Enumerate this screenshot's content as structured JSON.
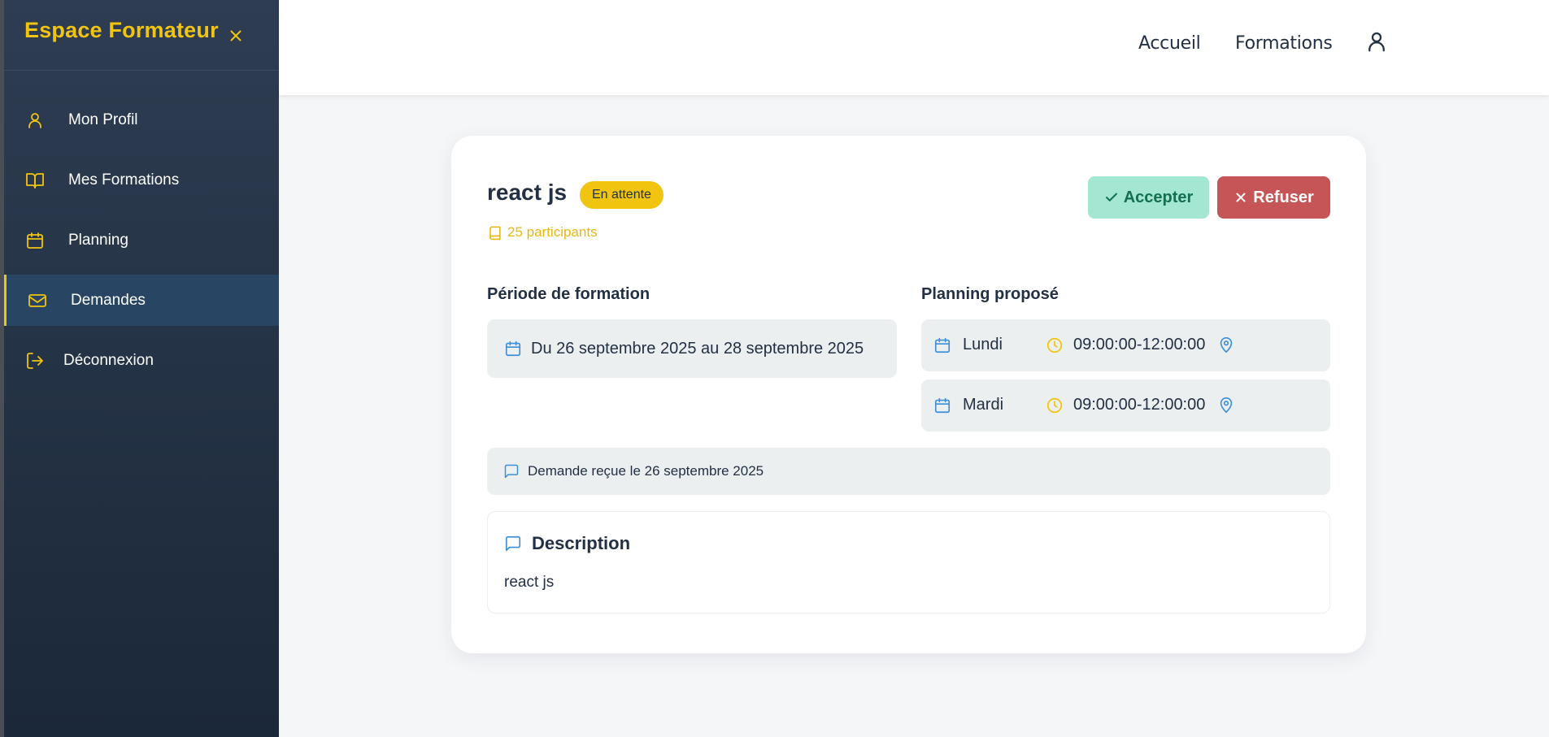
{
  "sidebar": {
    "title": "Espace Formateur",
    "items": [
      {
        "label": "Mon Profil",
        "icon": "user-icon"
      },
      {
        "label": "Mes Formations",
        "icon": "book-open-icon"
      },
      {
        "label": "Planning",
        "icon": "calendar-icon"
      },
      {
        "label": "Demandes",
        "icon": "mail-icon",
        "active": true
      },
      {
        "label": "Déconnexion",
        "icon": "logout-icon"
      }
    ]
  },
  "topbar": {
    "links": [
      "Accueil",
      "Formations"
    ],
    "user_icon": "user-icon"
  },
  "request": {
    "title": "react js",
    "status": "En attente",
    "participants": "25 participants",
    "accept_label": "Accepter",
    "refuse_label": "Refuser",
    "period_label": "Période de formation",
    "period_text": "Du 26 septembre 2025 au 28 septembre 2025",
    "planning_label": "Planning proposé",
    "planning": [
      {
        "day": "Lundi",
        "time": "09:00:00-12:00:00"
      },
      {
        "day": "Mardi",
        "time": "09:00:00-12:00:00"
      }
    ],
    "received_text": "Demande reçue le 26 septembre 2025",
    "description_heading": "Description",
    "description_text": "react js"
  },
  "colors": {
    "accent_yellow": "#f1c40f",
    "sidebar_bg": "#233044",
    "accept_bg": "#a3e6d2",
    "refuse_bg": "#c65558",
    "icon_blue": "#3a8fd9"
  }
}
